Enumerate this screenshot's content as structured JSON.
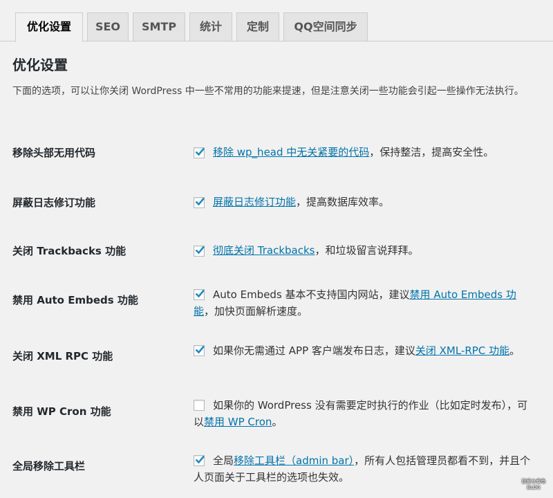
{
  "tabs": [
    {
      "label": "优化设置",
      "active": true
    },
    {
      "label": "SEO"
    },
    {
      "label": "SMTP"
    },
    {
      "label": "统计"
    },
    {
      "label": "定制"
    },
    {
      "label": "QQ空间同步"
    }
  ],
  "section": {
    "title": "优化设置",
    "intro": "下面的选项，可以让你关闭 WordPress 中一些不常用的功能来提速，但是注意关闭一些功能会引起一些操作无法执行。"
  },
  "options": [
    {
      "label": "移除头部无用代码",
      "checked": true,
      "pre": "",
      "link": "移除 wp_head 中无关紧要的代码",
      "post": "，保持整洁，提高安全性。"
    },
    {
      "label": "屏蔽日志修订功能",
      "checked": true,
      "pre": "",
      "link": "屏蔽日志修订功能",
      "post": "，提高数据库效率。"
    },
    {
      "label": "关闭 Trackbacks 功能",
      "checked": true,
      "pre": "",
      "link": "彻底关闭 Trackbacks",
      "post": "，和垃圾留言说拜拜。"
    },
    {
      "label": "禁用 Auto Embeds 功能",
      "checked": true,
      "pre": "Auto Embeds 基本不支持国内网站，建议",
      "link": "禁用 Auto Embeds 功能",
      "post": "，加快页面解析速度。"
    },
    {
      "label": "关闭 XML RPC 功能",
      "checked": true,
      "pre": "如果你无需通过 APP 客户端发布日志，建议",
      "link": "关闭 XML-RPC 功能",
      "post": "。"
    },
    {
      "label": "禁用 WP Cron 功能",
      "checked": false,
      "pre": "如果你的 WordPress 没有需要定时执行的作业（比如定时发布），可以",
      "link": "禁用 WP Cron",
      "post": "。"
    },
    {
      "label": "全局移除工具栏",
      "checked": true,
      "pre": "全局",
      "link": "移除工具栏（admin bar）",
      "post": "，所有人包括管理员都看不到，并且个人页面关于工具栏的选项也失效。"
    }
  ],
  "watermark": {
    "line1": "我爱水煮鱼",
    "line2": "BLOG"
  },
  "colors": {
    "link": "#0073aa",
    "checkmark": "#1e8cbe",
    "background": "#f1f1f1"
  }
}
